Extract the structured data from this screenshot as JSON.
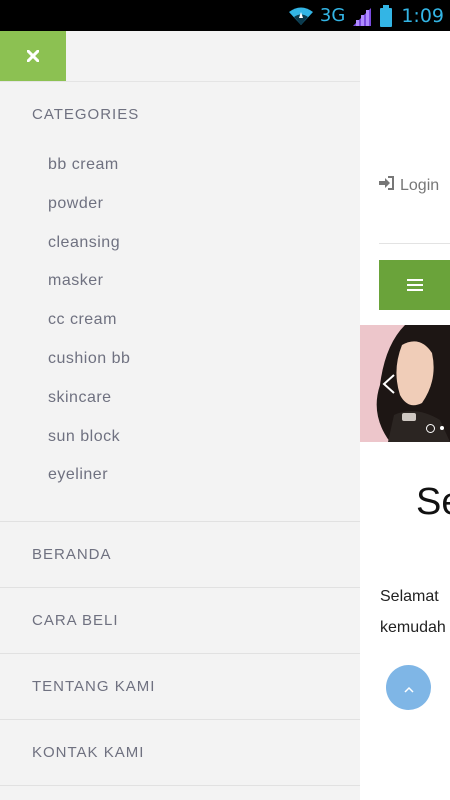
{
  "status_bar": {
    "network": "3G",
    "time": "1:09"
  },
  "drawer": {
    "close_icon": "close-icon",
    "categories_heading": "CATEGORIES",
    "categories": [
      "bb cream",
      "powder",
      "cleansing",
      "masker",
      "cc cream",
      "cushion bb",
      "skincare",
      "sun block",
      "eyeliner"
    ],
    "nav": [
      "BERANDA",
      "CARA BELI",
      "TENTANG KAMI",
      "KONTAK KAMI"
    ]
  },
  "page": {
    "login_label": "Login",
    "heading_fragment": "Se",
    "welcome_line1": "Selamat",
    "welcome_line2": "kemudah"
  },
  "colors": {
    "accent_green": "#8cc152",
    "menu_green": "#6aa33a",
    "scroll_blue": "#7fb6e6",
    "drawer_bg": "#f3f3f3",
    "text_gray": "#6f7180"
  }
}
